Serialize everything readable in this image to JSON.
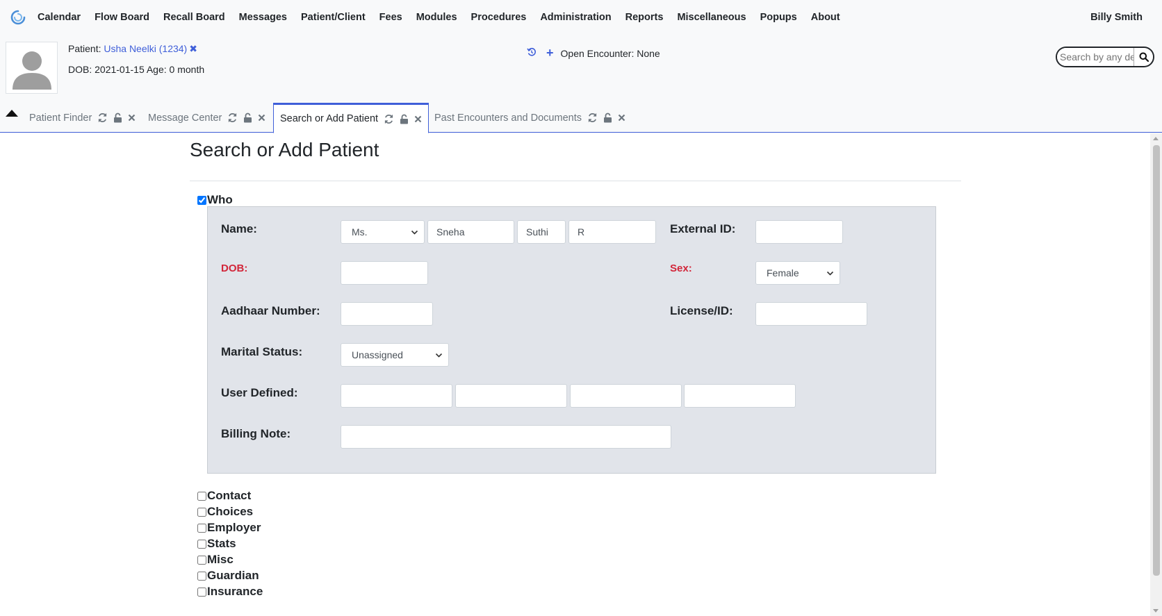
{
  "nav": {
    "items": [
      "Calendar",
      "Flow Board",
      "Recall Board",
      "Messages",
      "Patient/Client",
      "Fees",
      "Modules",
      "Procedures",
      "Administration",
      "Reports",
      "Miscellaneous",
      "Popups",
      "About"
    ],
    "user": "Billy Smith"
  },
  "patient": {
    "label": "Patient:",
    "name": "Usha Neelki (1234)",
    "dob_line": "DOB: 2021-01-15 Age: 0 month"
  },
  "encounter": {
    "text": "Open Encounter: None"
  },
  "search": {
    "placeholder": "Search by any demographics"
  },
  "tabs": [
    {
      "label": "Patient Finder",
      "active": false
    },
    {
      "label": "Message Center",
      "active": false
    },
    {
      "label": "Search or Add Patient",
      "active": true
    },
    {
      "label": "Past Encounters and Documents",
      "active": false
    }
  ],
  "page": {
    "title": "Search or Add Patient",
    "who_label": "Who",
    "fields": {
      "name_label": "Name:",
      "title_value": "Ms.",
      "first_name": "Sneha",
      "middle_name": "Suthi",
      "last_name": "R",
      "external_id_label": "External ID:",
      "dob_label": "DOB:",
      "sex_label": "Sex:",
      "sex_value": "Female",
      "aadhaar_label": "Aadhaar Number:",
      "license_label": "License/ID:",
      "marital_label": "Marital Status:",
      "marital_value": "Unassigned",
      "user_defined_label": "User Defined:",
      "billing_note_label": "Billing Note:"
    },
    "sections": [
      "Contact",
      "Choices",
      "Employer",
      "Stats",
      "Misc",
      "Guardian",
      "Insurance"
    ]
  },
  "colors": {
    "accent": "#3f5fd9",
    "required": "#d2263a",
    "panel": "#e1e4ea"
  }
}
